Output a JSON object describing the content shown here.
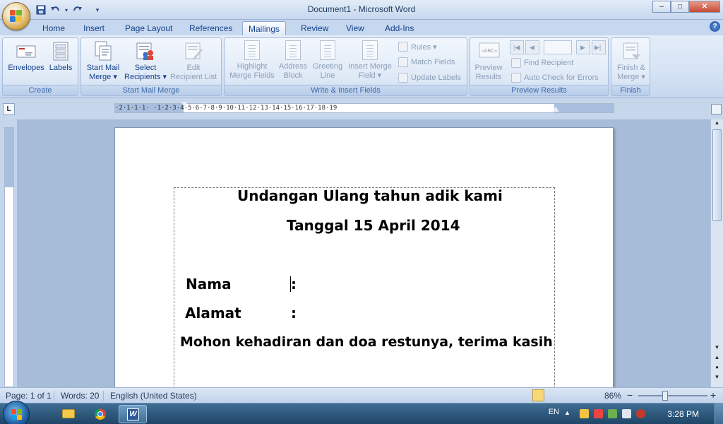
{
  "window": {
    "title": "Document1 - Microsoft Word",
    "controls": {
      "minimize": "–",
      "maximize": "□",
      "close": "✕"
    }
  },
  "quick_access": [
    "save-icon",
    "undo-icon",
    "redo-icon",
    "customize-icon"
  ],
  "tabs": [
    {
      "label": "Home"
    },
    {
      "label": "Insert"
    },
    {
      "label": "Page Layout"
    },
    {
      "label": "References"
    },
    {
      "label": "Mailings",
      "active": true
    },
    {
      "label": "Review"
    },
    {
      "label": "View"
    },
    {
      "label": "Add-Ins"
    }
  ],
  "ribbon": {
    "create": {
      "label": "Create",
      "envelopes": "Envelopes",
      "labels": "Labels"
    },
    "start_mail_merge": {
      "label": "Start Mail Merge",
      "start_l1": "Start Mail",
      "start_l2": "Merge ▾",
      "select_l1": "Select",
      "select_l2": "Recipients ▾",
      "edit_l1": "Edit",
      "edit_l2": "Recipient List"
    },
    "write_insert": {
      "label": "Write & Insert Fields",
      "highlight_l1": "Highlight",
      "highlight_l2": "Merge Fields",
      "address_l1": "Address",
      "address_l2": "Block",
      "greeting_l1": "Greeting",
      "greeting_l2": "Line",
      "insert_l1": "Insert Merge",
      "insert_l2": "Field ▾",
      "rules": "Rules ▾",
      "match_fields": "Match Fields",
      "update_labels": "Update Labels"
    },
    "preview": {
      "label": "Preview Results",
      "preview_l1": "Preview",
      "preview_l2": "Results",
      "preview_icon_text": "«ABC»",
      "find_recipient": "Find Recipient",
      "auto_check": "Auto Check for Errors"
    },
    "finish": {
      "label": "Finish",
      "finish_l1": "Finish &",
      "finish_l2": "Merge ▾"
    }
  },
  "ruler": {
    "corner": "L",
    "numbers": "·2·1·1·1·  ·1·2·3·4·5·6·7·8·9·10·11·12·13·14·15·16·17·18·19"
  },
  "document": {
    "line1": "Undangan Ulang tahun adik kami",
    "line2": "Tanggal 15 April 2014",
    "nama_label": "Nama",
    "nama_colon": ":",
    "alamat_label": "Alamat",
    "alamat_colon": ":",
    "closing": "Mohon kehadiran dan doa restunya, terima kasih"
  },
  "status": {
    "page": "Page: 1 of 1",
    "words": "Words: 20",
    "language": "English (United States)",
    "zoom": "86%",
    "zoom_out": "−",
    "zoom_in": "+"
  },
  "taskbar": {
    "language": "EN",
    "time": "3:28 PM"
  },
  "colors": {
    "accent_blue": "#15428b",
    "ribbon_bg": "#d5e3f4",
    "doc_bg": "#a7bcd9",
    "taskbar": "#2b577c"
  }
}
